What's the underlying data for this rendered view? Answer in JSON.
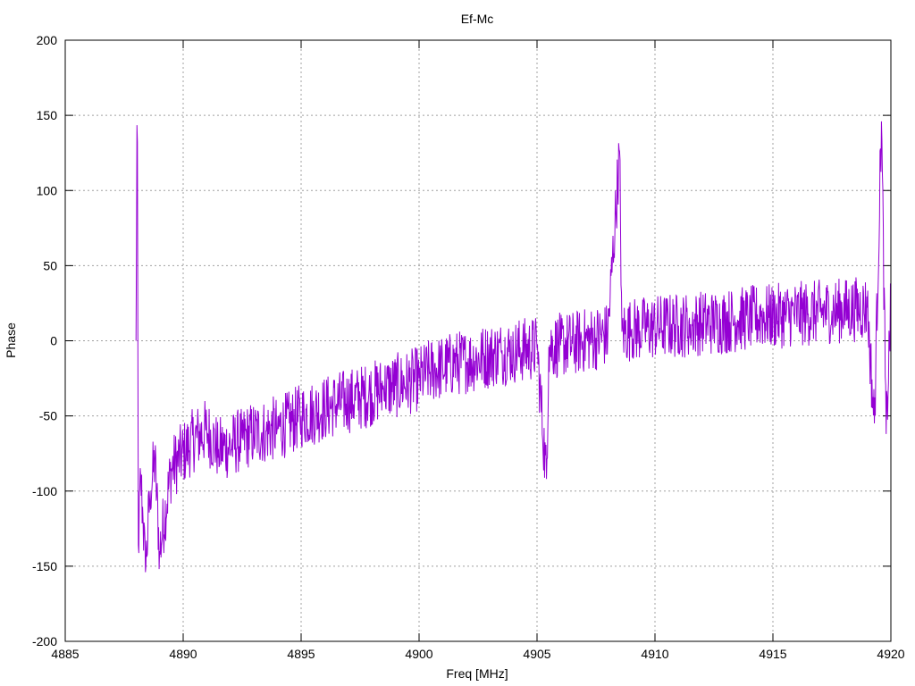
{
  "chart_data": {
    "type": "line",
    "title": "Ef-Mc",
    "xlabel": "Freq [MHz]",
    "ylabel": "Phase",
    "xlim": [
      4885,
      4920
    ],
    "ylim": [
      -200,
      200
    ],
    "xticks": [
      4885,
      4890,
      4895,
      4900,
      4905,
      4910,
      4915,
      4920
    ],
    "yticks": [
      -200,
      -150,
      -100,
      -50,
      0,
      50,
      100,
      150,
      200
    ],
    "xtick_labels": [
      "4885",
      "4890",
      "4895",
      "4900",
      "4905",
      "4910",
      "4915",
      "4920"
    ],
    "ytick_labels": [
      "-200",
      "-150",
      "-100",
      "-50",
      "0",
      "50",
      "100",
      "150",
      "200"
    ],
    "grid": true,
    "legend": "none",
    "series": [
      {
        "color": "#9400d3",
        "x_start": 4888.0,
        "x_end": 4920.0,
        "trend_note_points": [
          [
            4888.0,
            0
          ],
          [
            4888.05,
            172
          ],
          [
            4888.1,
            -136
          ],
          [
            4888.2,
            -90
          ],
          [
            4888.3,
            -120
          ],
          [
            4888.4,
            -154
          ],
          [
            4888.6,
            -100
          ],
          [
            4888.8,
            -80
          ],
          [
            4889.0,
            -140
          ],
          [
            4889.5,
            -85
          ],
          [
            4890.0,
            -75
          ],
          [
            4890.5,
            -65
          ],
          [
            4891.0,
            -60
          ],
          [
            4891.5,
            -72
          ],
          [
            4892.0,
            -70
          ],
          [
            4892.5,
            -65
          ],
          [
            4893.0,
            -62
          ],
          [
            4893.5,
            -60
          ],
          [
            4894.0,
            -58
          ],
          [
            4894.5,
            -55
          ],
          [
            4895.0,
            -50
          ],
          [
            4895.5,
            -48
          ],
          [
            4896.0,
            -45
          ],
          [
            4896.5,
            -42
          ],
          [
            4897.0,
            -40
          ],
          [
            4897.5,
            -38
          ],
          [
            4898.0,
            -35
          ],
          [
            4898.5,
            -32
          ],
          [
            4899.0,
            -30
          ],
          [
            4899.5,
            -28
          ],
          [
            4900.0,
            -25
          ],
          [
            4900.5,
            -20
          ],
          [
            4901.0,
            -18
          ],
          [
            4901.5,
            -15
          ],
          [
            4902.0,
            -14
          ],
          [
            4902.5,
            -12
          ],
          [
            4903.0,
            -10
          ],
          [
            4903.5,
            -8
          ],
          [
            4904.0,
            -7
          ],
          [
            4904.5,
            -6
          ],
          [
            4905.0,
            -5
          ],
          [
            4905.4,
            -92
          ],
          [
            4905.5,
            -4
          ],
          [
            4906.0,
            -3
          ],
          [
            4906.5,
            -2
          ],
          [
            4907.0,
            0
          ],
          [
            4907.5,
            2
          ],
          [
            4908.0,
            4
          ],
          [
            4908.5,
            126
          ],
          [
            4908.6,
            6
          ],
          [
            4909.0,
            7
          ],
          [
            4909.5,
            8
          ],
          [
            4910.0,
            9
          ],
          [
            4910.5,
            10
          ],
          [
            4911.0,
            10
          ],
          [
            4911.5,
            11
          ],
          [
            4912.0,
            12
          ],
          [
            4912.5,
            12
          ],
          [
            4913.0,
            13
          ],
          [
            4913.5,
            14
          ],
          [
            4914.0,
            15
          ],
          [
            4914.5,
            16
          ],
          [
            4915.0,
            16
          ],
          [
            4915.5,
            17
          ],
          [
            4916.0,
            18
          ],
          [
            4916.5,
            18
          ],
          [
            4917.0,
            19
          ],
          [
            4917.5,
            20
          ],
          [
            4918.0,
            20
          ],
          [
            4918.5,
            21
          ],
          [
            4919.0,
            22
          ],
          [
            4919.3,
            -55
          ],
          [
            4919.6,
            146
          ],
          [
            4919.8,
            -62
          ],
          [
            4920.0,
            25
          ]
        ],
        "noise_amplitude": 22
      }
    ]
  }
}
